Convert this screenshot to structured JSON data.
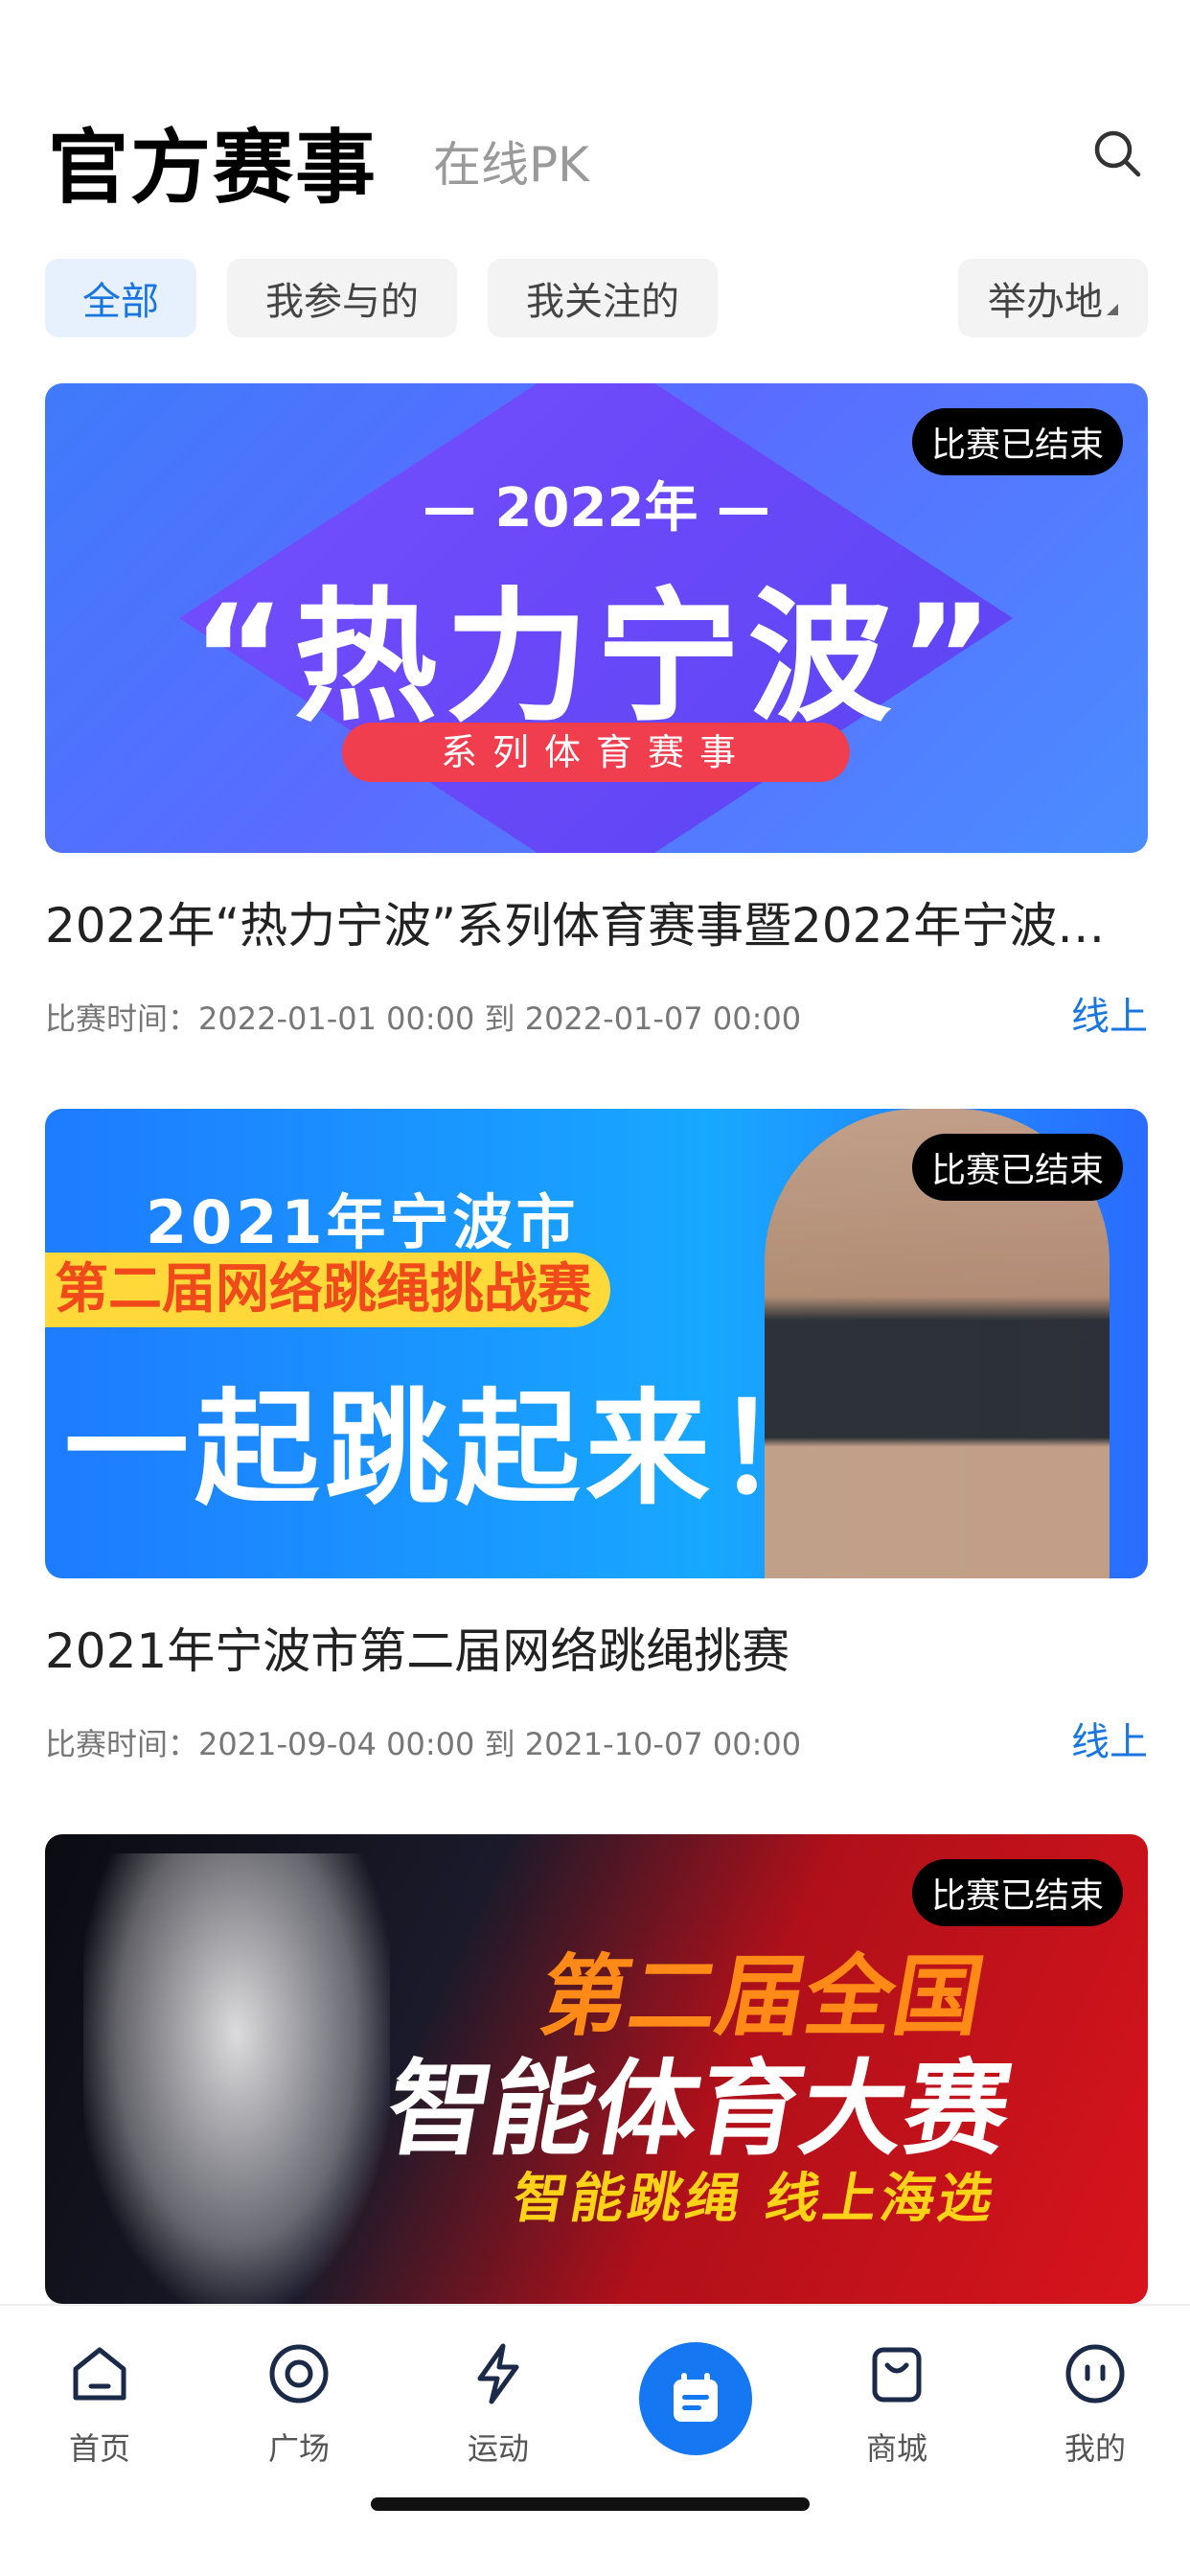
{
  "header": {
    "title": "官方赛事",
    "subtab": "在线PK",
    "search_icon": "search-icon"
  },
  "filters": {
    "chips": [
      {
        "label": "全部",
        "active": true
      },
      {
        "label": "我参与的",
        "active": false
      },
      {
        "label": "我关注的",
        "active": false
      }
    ],
    "location": "举办地"
  },
  "events": [
    {
      "status": "比赛已结束",
      "banner_year": "— 2022年 —",
      "banner_main": "“热力宁波”",
      "banner_ribbon": "系列体育赛事",
      "title": "2022年“热力宁波”系列体育赛事暨2022年宁波…",
      "time": "比赛时间：2022-01-01 00:00 到 2022-01-07 00:00",
      "type": "线上"
    },
    {
      "status": "比赛已结束",
      "banner_line1": "2021年宁波市",
      "banner_line2": "第二届网络跳绳挑战赛",
      "banner_line3": "一起跳起来！",
      "title": "2021年宁波市第二届网络跳绳挑赛",
      "time": "比赛时间：2021-09-04 00:00 到 2021-10-07 00:00",
      "type": "线上"
    },
    {
      "status": "比赛已结束",
      "banner_line1": "第二届全国",
      "banner_line2": "智能体育大赛",
      "banner_line3": "智能跳绳 线上海选"
    }
  ],
  "tabbar": {
    "items": [
      {
        "label": "首页",
        "icon": "home-icon"
      },
      {
        "label": "广场",
        "icon": "plaza-icon"
      },
      {
        "label": "运动",
        "icon": "lightning-icon"
      },
      {
        "label": "",
        "icon": "calendar-icon"
      },
      {
        "label": "商城",
        "icon": "shopping-bag-icon"
      },
      {
        "label": "我的",
        "icon": "profile-icon"
      }
    ]
  },
  "colors": {
    "accent": "#1677f2",
    "active_chip_bg": "#e6f1fd",
    "badge_bg": "#000000"
  }
}
